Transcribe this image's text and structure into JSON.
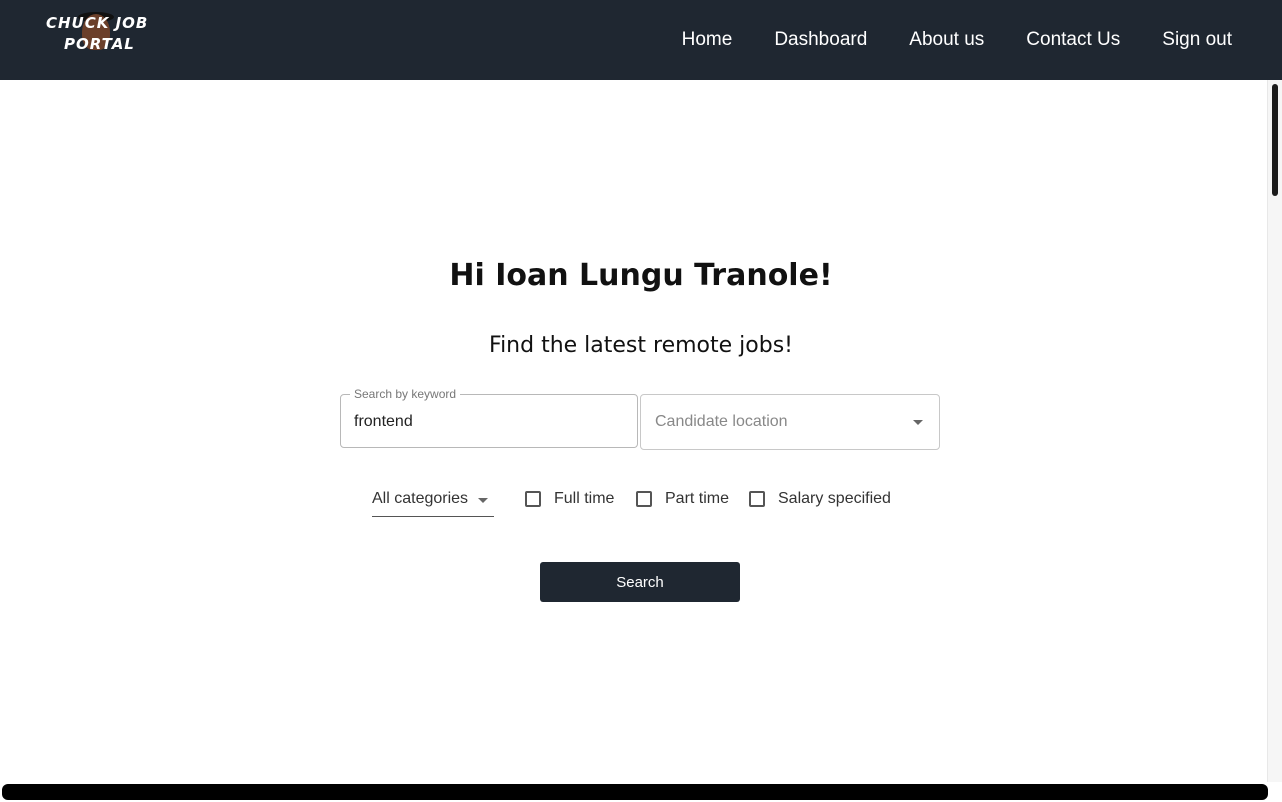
{
  "brand": {
    "logo_line1": "CHUCK JOB",
    "logo_line2": "PORTAL"
  },
  "nav": {
    "items": [
      {
        "label": "Home"
      },
      {
        "label": "Dashboard"
      },
      {
        "label": "About us"
      },
      {
        "label": "Contact Us"
      },
      {
        "label": "Sign out"
      }
    ]
  },
  "hero": {
    "greeting": "Hi Ioan Lungu Tranole!",
    "subtitle": "Find the latest remote jobs!"
  },
  "search": {
    "keyword_label": "Search by keyword",
    "keyword_value": "frontend",
    "location_placeholder": "Candidate location",
    "category_selected": "All categories",
    "checkboxes": [
      {
        "label": "Full time",
        "checked": false
      },
      {
        "label": "Part time",
        "checked": false
      },
      {
        "label": "Salary specified",
        "checked": false
      }
    ],
    "button_label": "Search"
  },
  "colors": {
    "navbar_bg": "#1f2731",
    "button_bg": "#1f2731",
    "text": "#111111"
  }
}
